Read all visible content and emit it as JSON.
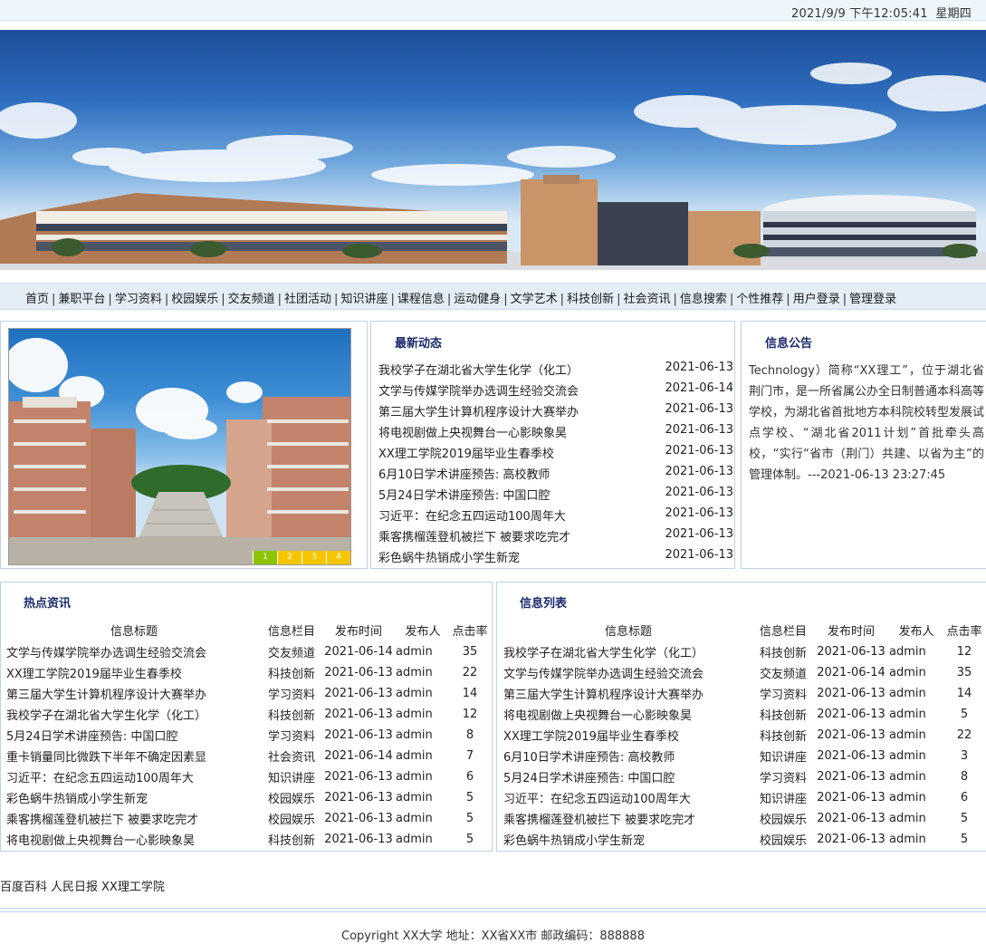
{
  "datebar": {
    "datetime": "2021/9/9 下午12:05:41",
    "weekday": "星期四"
  },
  "nav": {
    "items": [
      "首页",
      "兼职平台",
      "学习资料",
      "校园娱乐",
      "交友频道",
      "社团活动",
      "知识讲座",
      "课程信息",
      "运动健身",
      "文学艺术",
      "科技创新",
      "社会资讯",
      "信息搜索",
      "个性推荐",
      "用户登录",
      "管理登录"
    ]
  },
  "slideshow": {
    "pages": [
      "1",
      "2",
      "3",
      "4"
    ],
    "active": 1,
    "colors": {
      "active": "#f2a400",
      "inactive": "#f7c600",
      "first": "#8cc400"
    }
  },
  "news": {
    "title": "最新动态",
    "items": [
      {
        "title": "我校学子在湖北省大学生化学（化工）",
        "date": "2021-06-13"
      },
      {
        "title": "文学与传媒学院举办选调生经验交流会",
        "date": "2021-06-14"
      },
      {
        "title": "第三届大学生计算机程序设计大赛举办",
        "date": "2021-06-13"
      },
      {
        "title": "将电视剧做上央视舞台一心影映象昊",
        "date": "2021-06-13"
      },
      {
        "title": "XX理工学院2019届毕业生春季校",
        "date": "2021-06-13"
      },
      {
        "title": "6月10日学术讲座预告: 高校教师",
        "date": "2021-06-13"
      },
      {
        "title": "5月24日学术讲座预告: 中国口腔",
        "date": "2021-06-13"
      },
      {
        "title": "习近平：在纪念五四运动100周年大",
        "date": "2021-06-13"
      },
      {
        "title": "乘客携榴莲登机被拦下 被要求吃完才",
        "date": "2021-06-13"
      },
      {
        "title": "彩色蜗牛热销成小学生新宠",
        "date": "2021-06-13"
      }
    ]
  },
  "notice": {
    "title": "信息公告",
    "text": "Technology）简称“XX理工”，位于湖北省荆门市，是一所省属公办全日制普通本科高等学校，为湖北省首批地方本科院校转型发展试点学校、“湖北省2011计划”首批牵头高校，“实行“省市（荆门）共建、以省为主”的管理体制。---2021-06-13 23:27:45"
  },
  "hot": {
    "title": "热点资讯",
    "headers": [
      "信息标题",
      "信息栏目",
      "发布时间",
      "发布人",
      "点击率"
    ],
    "rows": [
      [
        "文学与传媒学院举办选调生经验交流会",
        "交友频道",
        "2021-06-14",
        "admin",
        "35"
      ],
      [
        "XX理工学院2019届毕业生春季校",
        "科技创新",
        "2021-06-13",
        "admin",
        "22"
      ],
      [
        "第三届大学生计算机程序设计大赛举办",
        "学习资料",
        "2021-06-13",
        "admin",
        "14"
      ],
      [
        "我校学子在湖北省大学生化学（化工）",
        "科技创新",
        "2021-06-13",
        "admin",
        "12"
      ],
      [
        "5月24日学术讲座预告: 中国口腔",
        "学习资料",
        "2021-06-13",
        "admin",
        "8"
      ],
      [
        "重卡销量同比微跌下半年不确定因素显",
        "社会资讯",
        "2021-06-14",
        "admin",
        "7"
      ],
      [
        "习近平：在纪念五四运动100周年大",
        "知识讲座",
        "2021-06-13",
        "admin",
        "6"
      ],
      [
        "彩色蜗牛热销成小学生新宠",
        "校园娱乐",
        "2021-06-13",
        "admin",
        "5"
      ],
      [
        "乘客携榴莲登机被拦下 被要求吃完才",
        "校园娱乐",
        "2021-06-13",
        "admin",
        "5"
      ],
      [
        "将电视剧做上央视舞台一心影映象昊",
        "科技创新",
        "2021-06-13",
        "admin",
        "5"
      ]
    ]
  },
  "info": {
    "title": "信息列表",
    "headers": [
      "信息标题",
      "信息栏目",
      "发布时间",
      "发布人",
      "点击率"
    ],
    "rows": [
      [
        "我校学子在湖北省大学生化学（化工）",
        "科技创新",
        "2021-06-13",
        "admin",
        "12"
      ],
      [
        "文学与传媒学院举办选调生经验交流会",
        "交友频道",
        "2021-06-14",
        "admin",
        "35"
      ],
      [
        "第三届大学生计算机程序设计大赛举办",
        "学习资料",
        "2021-06-13",
        "admin",
        "14"
      ],
      [
        "将电视剧做上央视舞台一心影映象昊",
        "科技创新",
        "2021-06-13",
        "admin",
        "5"
      ],
      [
        "XX理工学院2019届毕业生春季校",
        "科技创新",
        "2021-06-13",
        "admin",
        "22"
      ],
      [
        "6月10日学术讲座预告: 高校教师",
        "知识讲座",
        "2021-06-13",
        "admin",
        "3"
      ],
      [
        "5月24日学术讲座预告: 中国口腔",
        "学习资料",
        "2021-06-13",
        "admin",
        "8"
      ],
      [
        "习近平：在纪念五四运动100周年大",
        "知识讲座",
        "2021-06-13",
        "admin",
        "6"
      ],
      [
        "乘客携榴莲登机被拦下 被要求吃完才",
        "校园娱乐",
        "2021-06-13",
        "admin",
        "5"
      ],
      [
        "彩色蜗牛热销成小学生新宠",
        "校园娱乐",
        "2021-06-13",
        "admin",
        "5"
      ]
    ]
  },
  "links": [
    "百度百科",
    "人民日报",
    "XX理工学院"
  ],
  "footer": {
    "copyright": "Copyright XX大学 地址：XX省XX市 邮政编码：888888"
  }
}
